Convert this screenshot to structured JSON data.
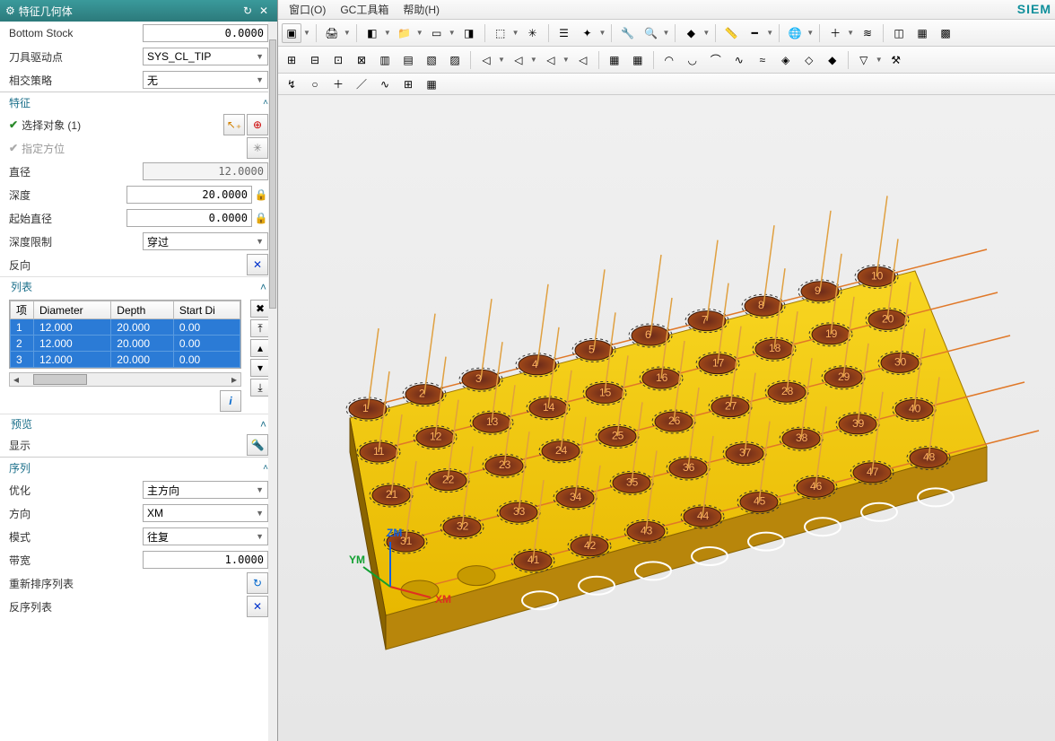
{
  "title": "特征几何体",
  "brand": "SIEM",
  "menus": [
    "窗口(O)",
    "GC工具箱",
    "帮助(H)"
  ],
  "top": {
    "bottom_stock_label": "Bottom Stock",
    "bottom_stock_value": "0.0000",
    "tool_drive_label": "刀具驱动点",
    "tool_drive_value": "SYS_CL_TIP",
    "intersect_label": "相交策略",
    "intersect_value": "无"
  },
  "feature": {
    "header": "特征",
    "select_label": "选择对象 (1)",
    "orient_label": "指定方位",
    "diameter_label": "直径",
    "diameter_value": "12.0000",
    "depth_label": "深度",
    "depth_value": "20.0000",
    "start_dia_label": "起始直径",
    "start_dia_value": "0.0000",
    "depth_limit_label": "深度限制",
    "depth_limit_value": "穿过",
    "reverse_label": "反向"
  },
  "list": {
    "header": "列表",
    "cols": [
      "项",
      "Diameter",
      "Depth",
      "Start Di"
    ],
    "rows": [
      {
        "i": "1",
        "d": "12.000",
        "p": "20.000",
        "s": "0.00"
      },
      {
        "i": "2",
        "d": "12.000",
        "p": "20.000",
        "s": "0.00"
      },
      {
        "i": "3",
        "d": "12.000",
        "p": "20.000",
        "s": "0.00"
      }
    ]
  },
  "preview": {
    "header": "预览",
    "show_label": "显示"
  },
  "sequence": {
    "header": "序列",
    "opt_label": "优化",
    "opt_value": "主方向",
    "dir_label": "方向",
    "dir_value": "XM",
    "mode_label": "模式",
    "mode_value": "往复",
    "band_label": "带宽",
    "band_value": "1.0000",
    "reorder_label": "重新排序列表",
    "revseq_label": "反序列表"
  },
  "triad": {
    "x": "XM",
    "y": "YM",
    "z": "ZM"
  }
}
